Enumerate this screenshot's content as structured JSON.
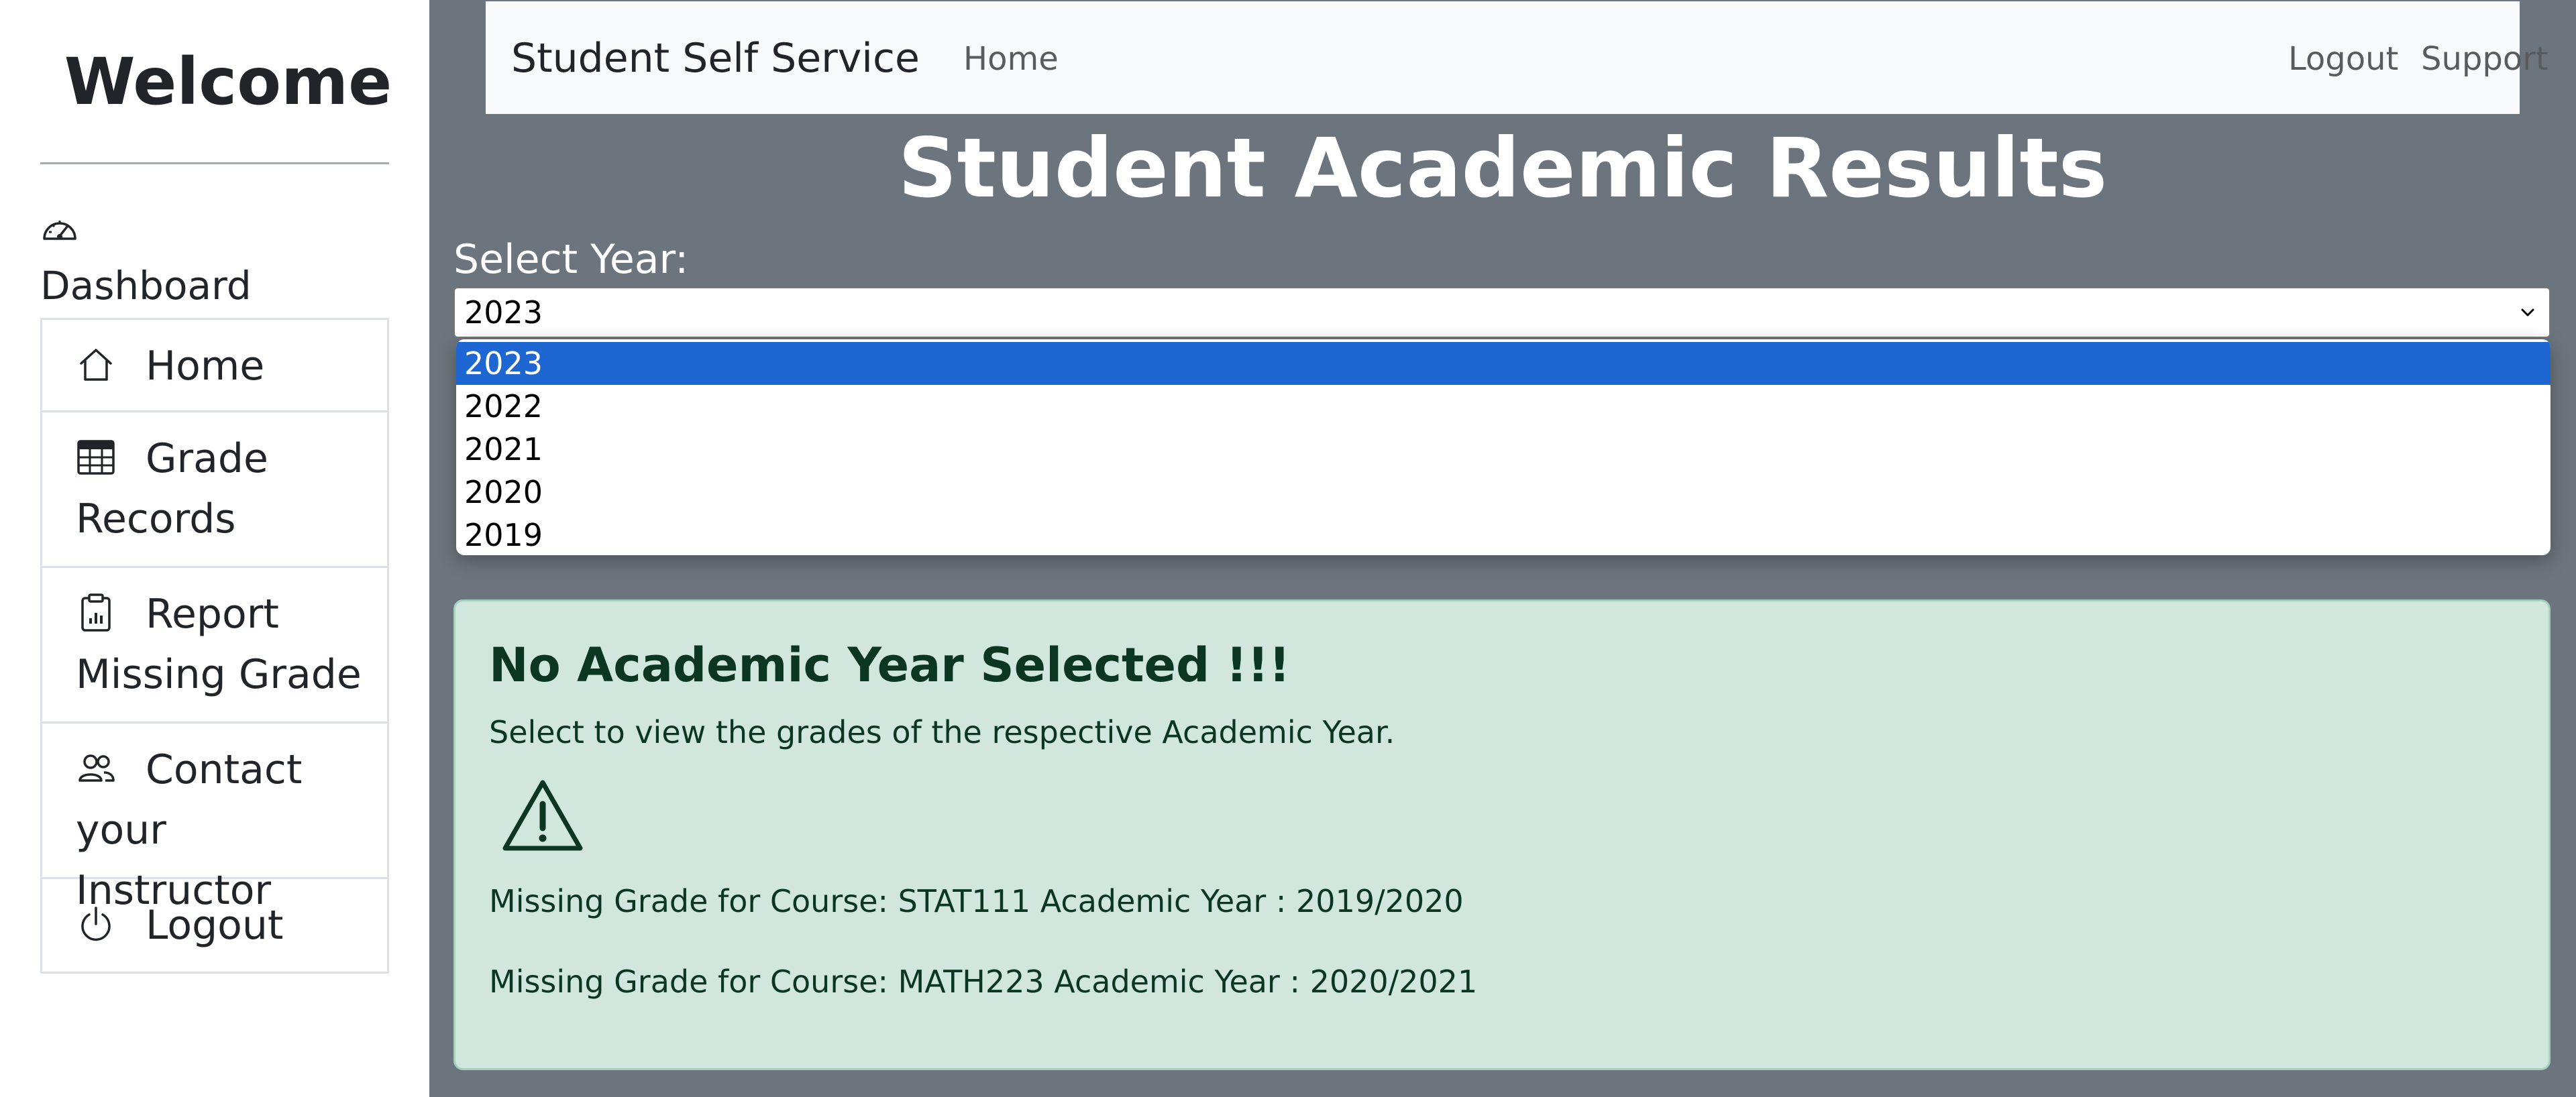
{
  "sidebar": {
    "welcome": "Welcome",
    "dashboard_icon": "speedometer-icon",
    "dashboard_label": "Dashboard",
    "items": [
      {
        "icon": "house-icon",
        "label_line1": "Home",
        "label_line2": ""
      },
      {
        "icon": "table-icon",
        "label_line1": "Grade",
        "label_line2": "Records"
      },
      {
        "icon": "clipboard-chart-icon",
        "label_line1": "Report",
        "label_line2": "Missing Grade"
      },
      {
        "icon": "people-icon",
        "label_line1": "Contact",
        "label_line2": "your Instructor"
      },
      {
        "icon": "power-icon",
        "label_line1": "Logout",
        "label_line2": ""
      }
    ]
  },
  "navbar": {
    "brand": "Student Self Service",
    "home": "Home",
    "logout": "Logout",
    "support": "Support"
  },
  "main": {
    "title": "Student Academic Results",
    "select_label": "Select Year:",
    "select_value": "2023",
    "options": [
      "2023",
      "2022",
      "2021",
      "2020",
      "2019"
    ],
    "highlighted_option": "2023"
  },
  "alert": {
    "heading": "No Academic Year Selected !!!",
    "text": "Select to view the grades of the respective Academic Year.",
    "icon": "warning-triangle-icon",
    "missing": [
      "Missing Grade for Course: STAT111 Academic Year : 2019/2020",
      "Missing Grade for Course: MATH223 Academic Year : 2020/2021"
    ]
  },
  "colors": {
    "main_bg": "#6c757d",
    "navbar_bg": "#f8f9fa",
    "selected_option": "#1e66d1",
    "alert_bg": "#d1e7dd",
    "alert_text": "#0a3622"
  }
}
